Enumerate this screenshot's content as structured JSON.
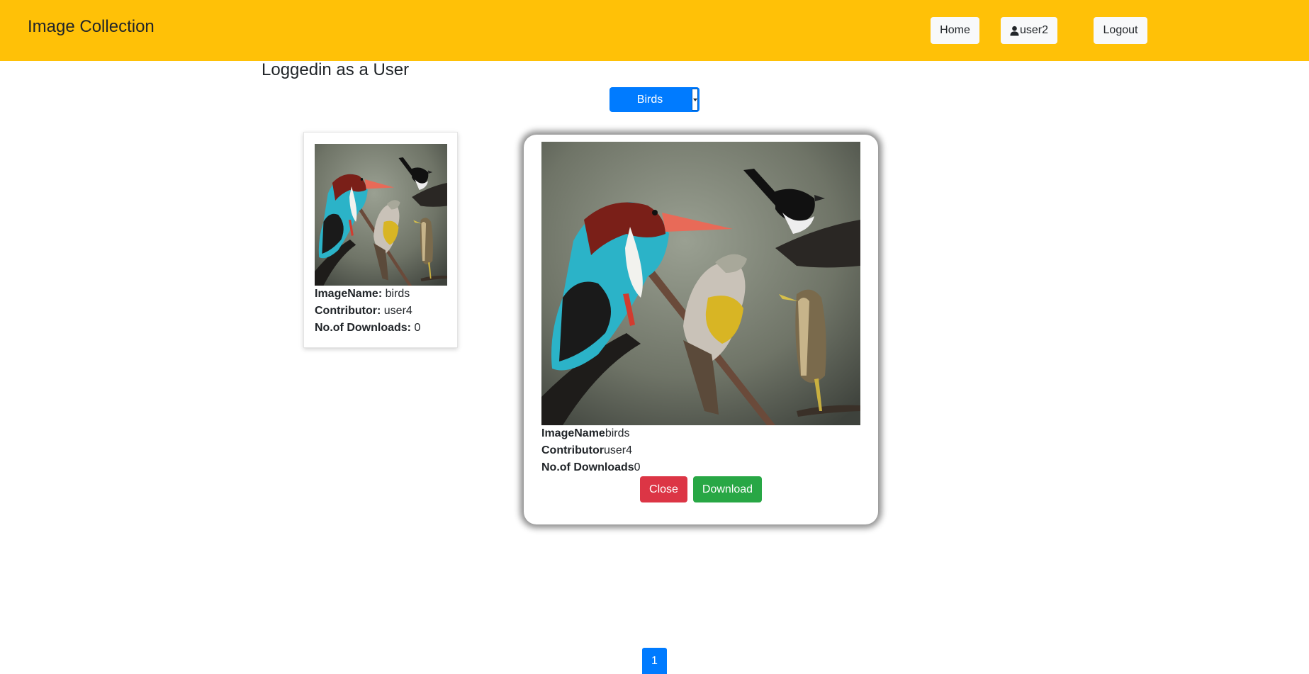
{
  "header": {
    "brand": "Image Collection",
    "home_label": "Home",
    "user_label": "user2",
    "logout_label": "Logout"
  },
  "main": {
    "logged_in_text": "Loggedin as a User",
    "category_dropdown": {
      "selected": "Birds"
    }
  },
  "card": {
    "image_name_label": "ImageName:",
    "image_name": "birds",
    "contributor_label": "Contributor:",
    "contributor": "user4",
    "downloads_label": "No.of Downloads:",
    "downloads": "0"
  },
  "modal": {
    "image_name_label": "ImageName",
    "image_name": "birds",
    "contributor_label": "Contributor",
    "contributor": "user4",
    "downloads_label": "No.of Downloads",
    "downloads": "0",
    "close_label": "Close",
    "download_label": "Download"
  },
  "pagination": {
    "current_page": "1"
  },
  "colors": {
    "header_bg": "#ffc107",
    "primary": "#007bff",
    "danger": "#dc3545",
    "success": "#28a745"
  },
  "icons": {
    "user": "user-icon"
  }
}
